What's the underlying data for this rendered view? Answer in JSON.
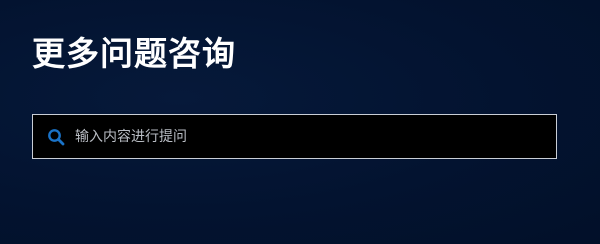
{
  "faq": {
    "title": "更多问题咨询",
    "search": {
      "placeholder": "输入内容进行提问",
      "value": "",
      "icon": "search-icon"
    }
  },
  "colors": {
    "background": "#03142f",
    "title": "#ffffff",
    "search_bg": "#000000",
    "search_border": "#c9ced6",
    "icon": "#1a73c8",
    "placeholder": "#b9bdc4"
  }
}
